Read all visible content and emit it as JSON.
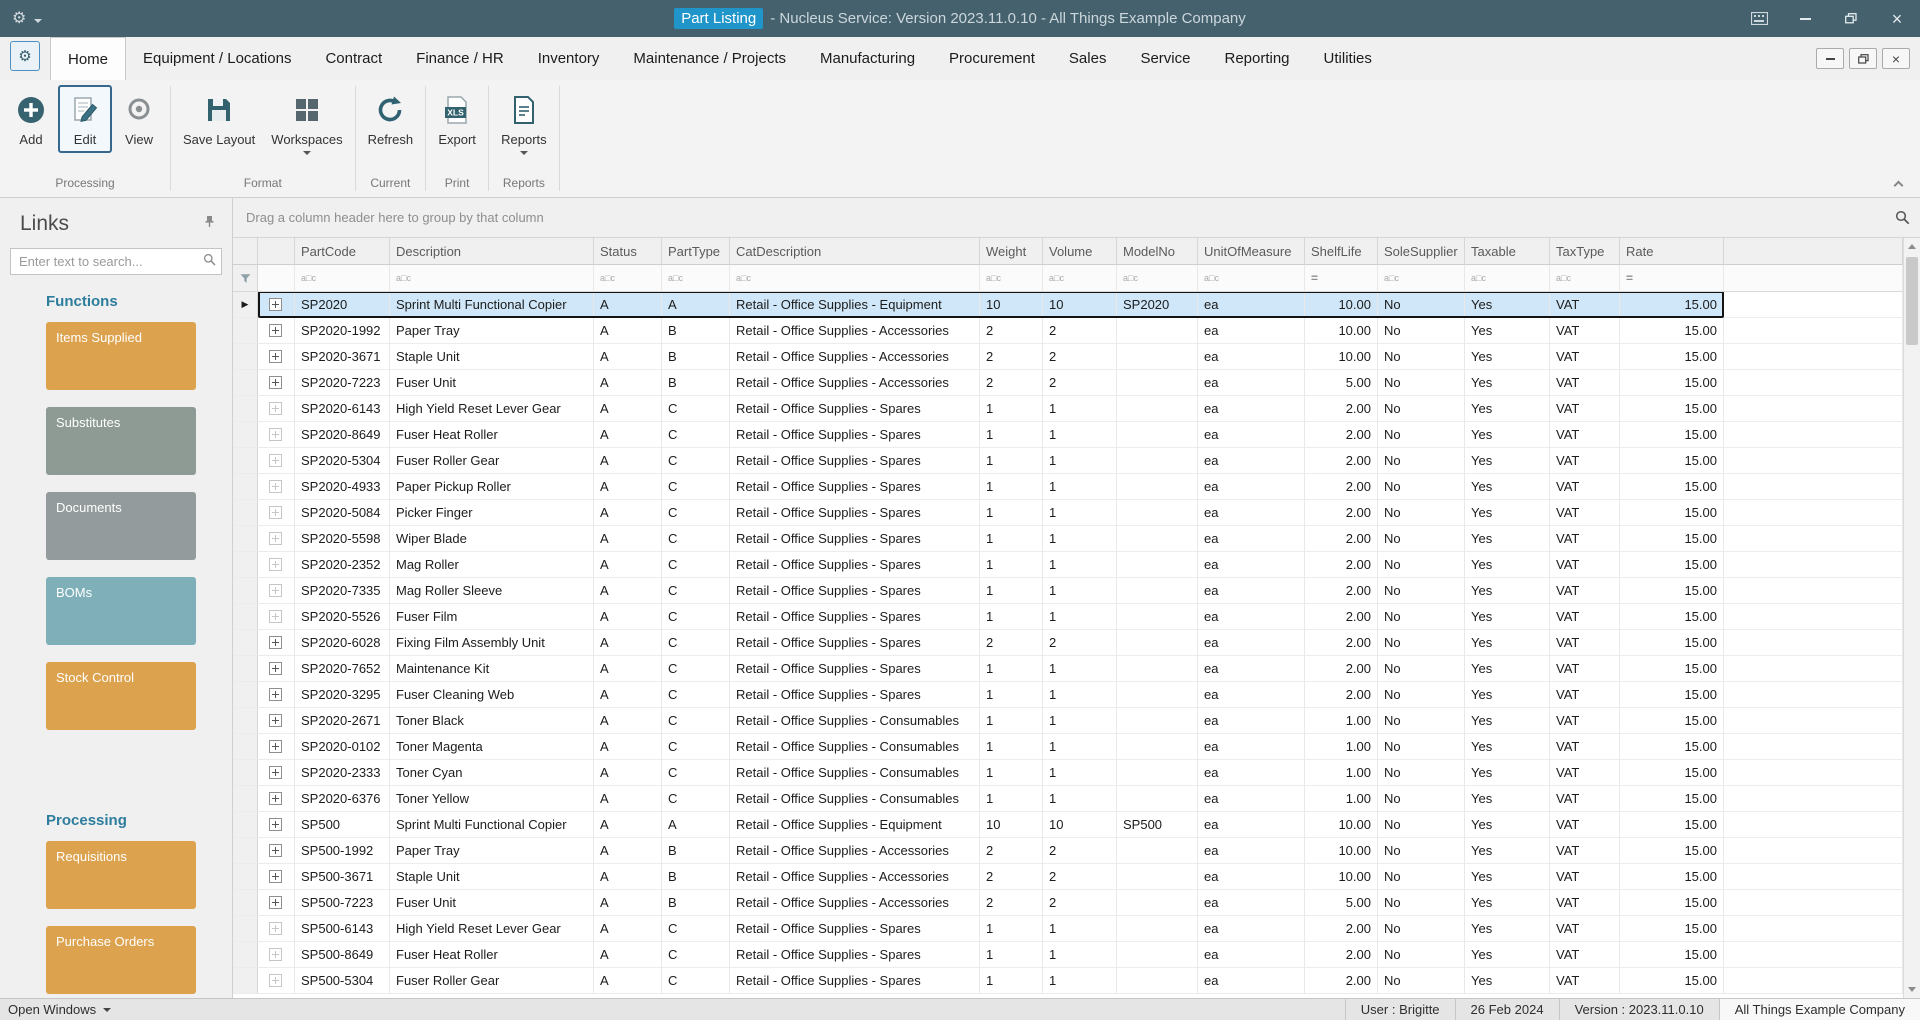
{
  "window": {
    "title_active": "Part Listing",
    "title_rest": "- Nucleus Service: Version 2023.11.0.10 - All Things Example Company"
  },
  "theme": {
    "titlebar_bg": "#45616d",
    "title_chip_bg": "#2095c9",
    "selected_row_bg": "#cfe7f8",
    "section_header_color": "#2d7d9c",
    "accent_dark_teal": "#33626f"
  },
  "ribbon": {
    "active_tab": "Home",
    "tabs": [
      "Home",
      "Equipment / Locations",
      "Contract",
      "Finance / HR",
      "Inventory",
      "Maintenance / Projects",
      "Manufacturing",
      "Procurement",
      "Sales",
      "Service",
      "Reporting",
      "Utilities"
    ],
    "groups": [
      {
        "label": "Processing",
        "buttons": [
          {
            "label": "Add"
          },
          {
            "label": "Edit"
          },
          {
            "label": "View"
          }
        ]
      },
      {
        "label": "Format",
        "buttons": [
          {
            "label": "Save Layout"
          },
          {
            "label": "Workspaces",
            "dropdown": true
          }
        ]
      },
      {
        "label": "Current",
        "buttons": [
          {
            "label": "Refresh"
          }
        ]
      },
      {
        "label": "Print",
        "buttons": [
          {
            "label": "Export"
          }
        ]
      },
      {
        "label": "Reports",
        "buttons": [
          {
            "label": "Reports",
            "dropdown": true
          }
        ]
      }
    ]
  },
  "sidebar": {
    "title": "Links",
    "search_placeholder": "Enter text to search...",
    "sections": [
      {
        "header": "Functions",
        "items": [
          {
            "label": "Items Supplied",
            "color": "#dda24d"
          },
          {
            "label": "Substitutes",
            "color": "#8d9b94"
          },
          {
            "label": "Documents",
            "color": "#949b9c"
          },
          {
            "label": "BOMs",
            "color": "#7fb0ba"
          },
          {
            "label": "Stock Control",
            "color": "#dda24d"
          }
        ]
      },
      {
        "header": "Processing",
        "items": [
          {
            "label": "Requisitions",
            "color": "#dda24d"
          },
          {
            "label": "Purchase Orders",
            "color": "#dda24d"
          }
        ]
      }
    ]
  },
  "grid": {
    "group_hint": "Drag a column header here to group by that column",
    "columns": [
      {
        "key": "partCode",
        "label": "PartCode",
        "filter": "abc"
      },
      {
        "key": "description",
        "label": "Description",
        "filter": "abc"
      },
      {
        "key": "status",
        "label": "Status",
        "filter": "abc"
      },
      {
        "key": "partType",
        "label": "PartType",
        "filter": "abc"
      },
      {
        "key": "catDescription",
        "label": "CatDescription",
        "filter": "abc"
      },
      {
        "key": "weight",
        "label": "Weight",
        "filter": "abc"
      },
      {
        "key": "volume",
        "label": "Volume",
        "filter": "abc"
      },
      {
        "key": "modelNo",
        "label": "ModelNo",
        "filter": "abc"
      },
      {
        "key": "unitOfMeasure",
        "label": "UnitOfMeasure",
        "filter": "abc"
      },
      {
        "key": "shelfLife",
        "label": "ShelfLife",
        "filter": "eq",
        "align": "right"
      },
      {
        "key": "soleSupplier",
        "label": "SoleSupplier",
        "filter": "abc"
      },
      {
        "key": "taxable",
        "label": "Taxable",
        "filter": "abc"
      },
      {
        "key": "taxType",
        "label": "TaxType",
        "filter": "abc"
      },
      {
        "key": "rate",
        "label": "Rate",
        "filter": "eq",
        "align": "right"
      }
    ],
    "selected_row_index": 0,
    "dim_expand_rows": [
      4,
      5,
      6,
      7,
      8,
      9,
      10,
      11,
      12,
      24,
      25,
      26
    ],
    "rows": [
      [
        "SP2020",
        "Sprint Multi Functional Copier",
        "A",
        "A",
        "Retail - Office Supplies - Equipment",
        "10",
        "10",
        "SP2020",
        "ea",
        "10.00",
        "No",
        "Yes",
        "VAT",
        "15.00"
      ],
      [
        "SP2020-1992",
        "Paper Tray",
        "A",
        "B",
        "Retail - Office Supplies - Accessories",
        "2",
        "2",
        "",
        "ea",
        "10.00",
        "No",
        "Yes",
        "VAT",
        "15.00"
      ],
      [
        "SP2020-3671",
        "Staple Unit",
        "A",
        "B",
        "Retail - Office Supplies - Accessories",
        "2",
        "2",
        "",
        "ea",
        "10.00",
        "No",
        "Yes",
        "VAT",
        "15.00"
      ],
      [
        "SP2020-7223",
        "Fuser Unit",
        "A",
        "B",
        "Retail - Office Supplies - Accessories",
        "2",
        "2",
        "",
        "ea",
        "5.00",
        "No",
        "Yes",
        "VAT",
        "15.00"
      ],
      [
        "SP2020-6143",
        "High Yield Reset Lever Gear",
        "A",
        "C",
        "Retail - Office Supplies - Spares",
        "1",
        "1",
        "",
        "ea",
        "2.00",
        "No",
        "Yes",
        "VAT",
        "15.00"
      ],
      [
        "SP2020-8649",
        "Fuser Heat Roller",
        "A",
        "C",
        "Retail - Office Supplies - Spares",
        "1",
        "1",
        "",
        "ea",
        "2.00",
        "No",
        "Yes",
        "VAT",
        "15.00"
      ],
      [
        "SP2020-5304",
        "Fuser Roller Gear",
        "A",
        "C",
        "Retail - Office Supplies - Spares",
        "1",
        "1",
        "",
        "ea",
        "2.00",
        "No",
        "Yes",
        "VAT",
        "15.00"
      ],
      [
        "SP2020-4933",
        "Paper Pickup Roller",
        "A",
        "C",
        "Retail - Office Supplies - Spares",
        "1",
        "1",
        "",
        "ea",
        "2.00",
        "No",
        "Yes",
        "VAT",
        "15.00"
      ],
      [
        "SP2020-5084",
        "Picker Finger",
        "A",
        "C",
        "Retail - Office Supplies - Spares",
        "1",
        "1",
        "",
        "ea",
        "2.00",
        "No",
        "Yes",
        "VAT",
        "15.00"
      ],
      [
        "SP2020-5598",
        "Wiper Blade",
        "A",
        "C",
        "Retail - Office Supplies - Spares",
        "1",
        "1",
        "",
        "ea",
        "2.00",
        "No",
        "Yes",
        "VAT",
        "15.00"
      ],
      [
        "SP2020-2352",
        "Mag Roller",
        "A",
        "C",
        "Retail - Office Supplies - Spares",
        "1",
        "1",
        "",
        "ea",
        "2.00",
        "No",
        "Yes",
        "VAT",
        "15.00"
      ],
      [
        "SP2020-7335",
        "Mag Roller Sleeve",
        "A",
        "C",
        "Retail - Office Supplies - Spares",
        "1",
        "1",
        "",
        "ea",
        "2.00",
        "No",
        "Yes",
        "VAT",
        "15.00"
      ],
      [
        "SP2020-5526",
        "Fuser Film",
        "A",
        "C",
        "Retail - Office Supplies - Spares",
        "1",
        "1",
        "",
        "ea",
        "2.00",
        "No",
        "Yes",
        "VAT",
        "15.00"
      ],
      [
        "SP2020-6028",
        "Fixing Film Assembly Unit",
        "A",
        "C",
        "Retail - Office Supplies - Spares",
        "2",
        "2",
        "",
        "ea",
        "2.00",
        "No",
        "Yes",
        "VAT",
        "15.00"
      ],
      [
        "SP2020-7652",
        "Maintenance Kit",
        "A",
        "C",
        "Retail - Office Supplies - Spares",
        "1",
        "1",
        "",
        "ea",
        "2.00",
        "No",
        "Yes",
        "VAT",
        "15.00"
      ],
      [
        "SP2020-3295",
        "Fuser Cleaning Web",
        "A",
        "C",
        "Retail - Office Supplies - Spares",
        "1",
        "1",
        "",
        "ea",
        "2.00",
        "No",
        "Yes",
        "VAT",
        "15.00"
      ],
      [
        "SP2020-2671",
        "Toner Black",
        "A",
        "C",
        "Retail - Office Supplies - Consumables",
        "1",
        "1",
        "",
        "ea",
        "1.00",
        "No",
        "Yes",
        "VAT",
        "15.00"
      ],
      [
        "SP2020-0102",
        "Toner Magenta",
        "A",
        "C",
        "Retail - Office Supplies - Consumables",
        "1",
        "1",
        "",
        "ea",
        "1.00",
        "No",
        "Yes",
        "VAT",
        "15.00"
      ],
      [
        "SP2020-2333",
        "Toner Cyan",
        "A",
        "C",
        "Retail - Office Supplies - Consumables",
        "1",
        "1",
        "",
        "ea",
        "1.00",
        "No",
        "Yes",
        "VAT",
        "15.00"
      ],
      [
        "SP2020-6376",
        "Toner Yellow",
        "A",
        "C",
        "Retail - Office Supplies - Consumables",
        "1",
        "1",
        "",
        "ea",
        "1.00",
        "No",
        "Yes",
        "VAT",
        "15.00"
      ],
      [
        "SP500",
        "Sprint Multi Functional Copier",
        "A",
        "A",
        "Retail - Office Supplies - Equipment",
        "10",
        "10",
        "SP500",
        "ea",
        "10.00",
        "No",
        "Yes",
        "VAT",
        "15.00"
      ],
      [
        "SP500-1992",
        "Paper Tray",
        "A",
        "B",
        "Retail - Office Supplies - Accessories",
        "2",
        "2",
        "",
        "ea",
        "10.00",
        "No",
        "Yes",
        "VAT",
        "15.00"
      ],
      [
        "SP500-3671",
        "Staple Unit",
        "A",
        "B",
        "Retail - Office Supplies - Accessories",
        "2",
        "2",
        "",
        "ea",
        "10.00",
        "No",
        "Yes",
        "VAT",
        "15.00"
      ],
      [
        "SP500-7223",
        "Fuser Unit",
        "A",
        "B",
        "Retail - Office Supplies - Accessories",
        "2",
        "2",
        "",
        "ea",
        "5.00",
        "No",
        "Yes",
        "VAT",
        "15.00"
      ],
      [
        "SP500-6143",
        "High Yield Reset Lever Gear",
        "A",
        "C",
        "Retail - Office Supplies - Spares",
        "1",
        "1",
        "",
        "ea",
        "2.00",
        "No",
        "Yes",
        "VAT",
        "15.00"
      ],
      [
        "SP500-8649",
        "Fuser Heat Roller",
        "A",
        "C",
        "Retail - Office Supplies - Spares",
        "1",
        "1",
        "",
        "ea",
        "2.00",
        "No",
        "Yes",
        "VAT",
        "15.00"
      ],
      [
        "SP500-5304",
        "Fuser Roller Gear",
        "A",
        "C",
        "Retail - Office Supplies - Spares",
        "1",
        "1",
        "",
        "ea",
        "2.00",
        "No",
        "Yes",
        "VAT",
        "15.00"
      ]
    ]
  },
  "statusbar": {
    "open_windows": "Open Windows",
    "user": "User : Brigitte",
    "date": "26 Feb 2024",
    "version": "Version : 2023.11.0.10",
    "company": "All Things Example Company"
  }
}
